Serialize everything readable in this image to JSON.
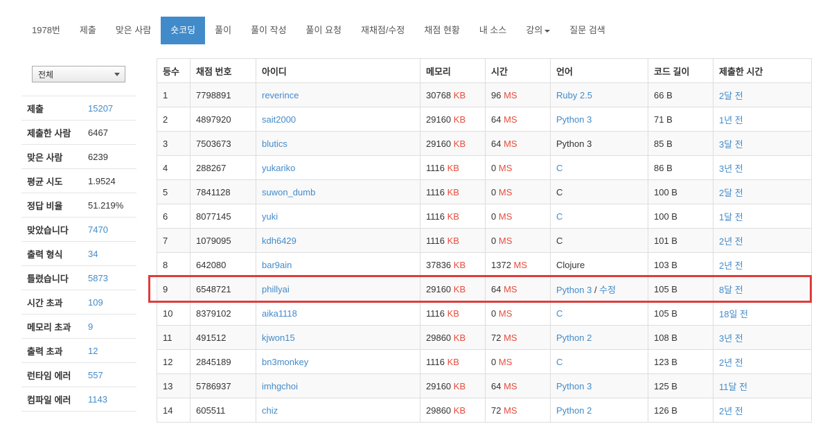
{
  "nav": {
    "tabs": [
      {
        "label": "1978번",
        "active": false
      },
      {
        "label": "제출",
        "active": false
      },
      {
        "label": "맞은 사람",
        "active": false
      },
      {
        "label": "숏코딩",
        "active": true
      },
      {
        "label": "풀이",
        "active": false
      },
      {
        "label": "풀이 작성",
        "active": false
      },
      {
        "label": "풀이 요청",
        "active": false
      },
      {
        "label": "재채점/수정",
        "active": false
      },
      {
        "label": "채점 현황",
        "active": false
      },
      {
        "label": "내 소스",
        "active": false
      },
      {
        "label": "강의",
        "active": false,
        "dropdown": true
      },
      {
        "label": "질문 검색",
        "active": false
      }
    ],
    "active_color": "#428bca"
  },
  "sidebar": {
    "filter": {
      "selected": "전체"
    },
    "stats": [
      {
        "label": "제출",
        "value": "15207",
        "link": true
      },
      {
        "label": "제출한 사람",
        "value": "6467",
        "link": false
      },
      {
        "label": "맞은 사람",
        "value": "6239",
        "link": false
      },
      {
        "label": "평균 시도",
        "value": "1.9524",
        "link": false
      },
      {
        "label": "정답 비율",
        "value": "51.219%",
        "link": false
      },
      {
        "label": "맞았습니다",
        "value": "7470",
        "link": true
      },
      {
        "label": "출력 형식",
        "value": "34",
        "link": true
      },
      {
        "label": "틀렸습니다",
        "value": "5873",
        "link": true
      },
      {
        "label": "시간 초과",
        "value": "109",
        "link": true
      },
      {
        "label": "메모리 초과",
        "value": "9",
        "link": true
      },
      {
        "label": "출력 초과",
        "value": "12",
        "link": true
      },
      {
        "label": "런타임 에러",
        "value": "557",
        "link": true
      },
      {
        "label": "컴파일 에러",
        "value": "1143",
        "link": true
      }
    ]
  },
  "table": {
    "headers": [
      "등수",
      "채점 번호",
      "아이디",
      "메모리",
      "시간",
      "언어",
      "코드 길이",
      "제출한 시간"
    ],
    "memory_unit": "KB",
    "time_unit": "MS",
    "unit_color": "#e74c3c",
    "link_color": "#428bca",
    "highlight_color": "#e03a3a",
    "highlighted_rank": "9",
    "rows": [
      {
        "rank": "1",
        "id": "7798891",
        "user": "reverince",
        "memory": "30768",
        "time": "96",
        "lang": "Ruby 2.5",
        "lang_link": true,
        "lang_edit": "",
        "length": "66 B",
        "submitted": "2달 전"
      },
      {
        "rank": "2",
        "id": "4897920",
        "user": "sait2000",
        "memory": "29160",
        "time": "64",
        "lang": "Python 3",
        "lang_link": true,
        "lang_edit": "",
        "length": "71 B",
        "submitted": "1년 전"
      },
      {
        "rank": "3",
        "id": "7503673",
        "user": "blutics",
        "memory": "29160",
        "time": "64",
        "lang": "Python 3",
        "lang_link": false,
        "lang_edit": "",
        "length": "85 B",
        "submitted": "3달 전"
      },
      {
        "rank": "4",
        "id": "288267",
        "user": "yukariko",
        "memory": "1116",
        "time": "0",
        "lang": "C",
        "lang_link": true,
        "lang_edit": "",
        "length": "86 B",
        "submitted": "3년 전"
      },
      {
        "rank": "5",
        "id": "7841128",
        "user": "suwon_dumb",
        "memory": "1116",
        "time": "0",
        "lang": "C",
        "lang_link": false,
        "lang_edit": "",
        "length": "100 B",
        "submitted": "2달 전"
      },
      {
        "rank": "6",
        "id": "8077145",
        "user": "yuki",
        "memory": "1116",
        "time": "0",
        "lang": "C",
        "lang_link": true,
        "lang_edit": "",
        "length": "100 B",
        "submitted": "1달 전"
      },
      {
        "rank": "7",
        "id": "1079095",
        "user": "kdh6429",
        "memory": "1116",
        "time": "0",
        "lang": "C",
        "lang_link": false,
        "lang_edit": "",
        "length": "101 B",
        "submitted": "2년 전"
      },
      {
        "rank": "8",
        "id": "642080",
        "user": "bar9ain",
        "memory": "37836",
        "time": "1372",
        "lang": "Clojure",
        "lang_link": false,
        "lang_edit": "",
        "length": "103 B",
        "submitted": "2년 전"
      },
      {
        "rank": "9",
        "id": "6548721",
        "user": "phillyai",
        "memory": "29160",
        "time": "64",
        "lang": "Python 3",
        "lang_link": true,
        "lang_edit": "수정",
        "length": "105 B",
        "submitted": "8달 전"
      },
      {
        "rank": "10",
        "id": "8379102",
        "user": "aika1118",
        "memory": "1116",
        "time": "0",
        "lang": "C",
        "lang_link": true,
        "lang_edit": "",
        "length": "105 B",
        "submitted": "18일 전"
      },
      {
        "rank": "11",
        "id": "491512",
        "user": "kjwon15",
        "memory": "29860",
        "time": "72",
        "lang": "Python 2",
        "lang_link": true,
        "lang_edit": "",
        "length": "108 B",
        "submitted": "3년 전"
      },
      {
        "rank": "12",
        "id": "2845189",
        "user": "bn3monkey",
        "memory": "1116",
        "time": "0",
        "lang": "C",
        "lang_link": true,
        "lang_edit": "",
        "length": "123 B",
        "submitted": "2년 전"
      },
      {
        "rank": "13",
        "id": "5786937",
        "user": "imhgchoi",
        "memory": "29160",
        "time": "64",
        "lang": "Python 3",
        "lang_link": true,
        "lang_edit": "",
        "length": "125 B",
        "submitted": "11달 전"
      },
      {
        "rank": "14",
        "id": "605511",
        "user": "chiz",
        "memory": "29860",
        "time": "72",
        "lang": "Python 2",
        "lang_link": true,
        "lang_edit": "",
        "length": "126 B",
        "submitted": "2년 전"
      }
    ]
  }
}
